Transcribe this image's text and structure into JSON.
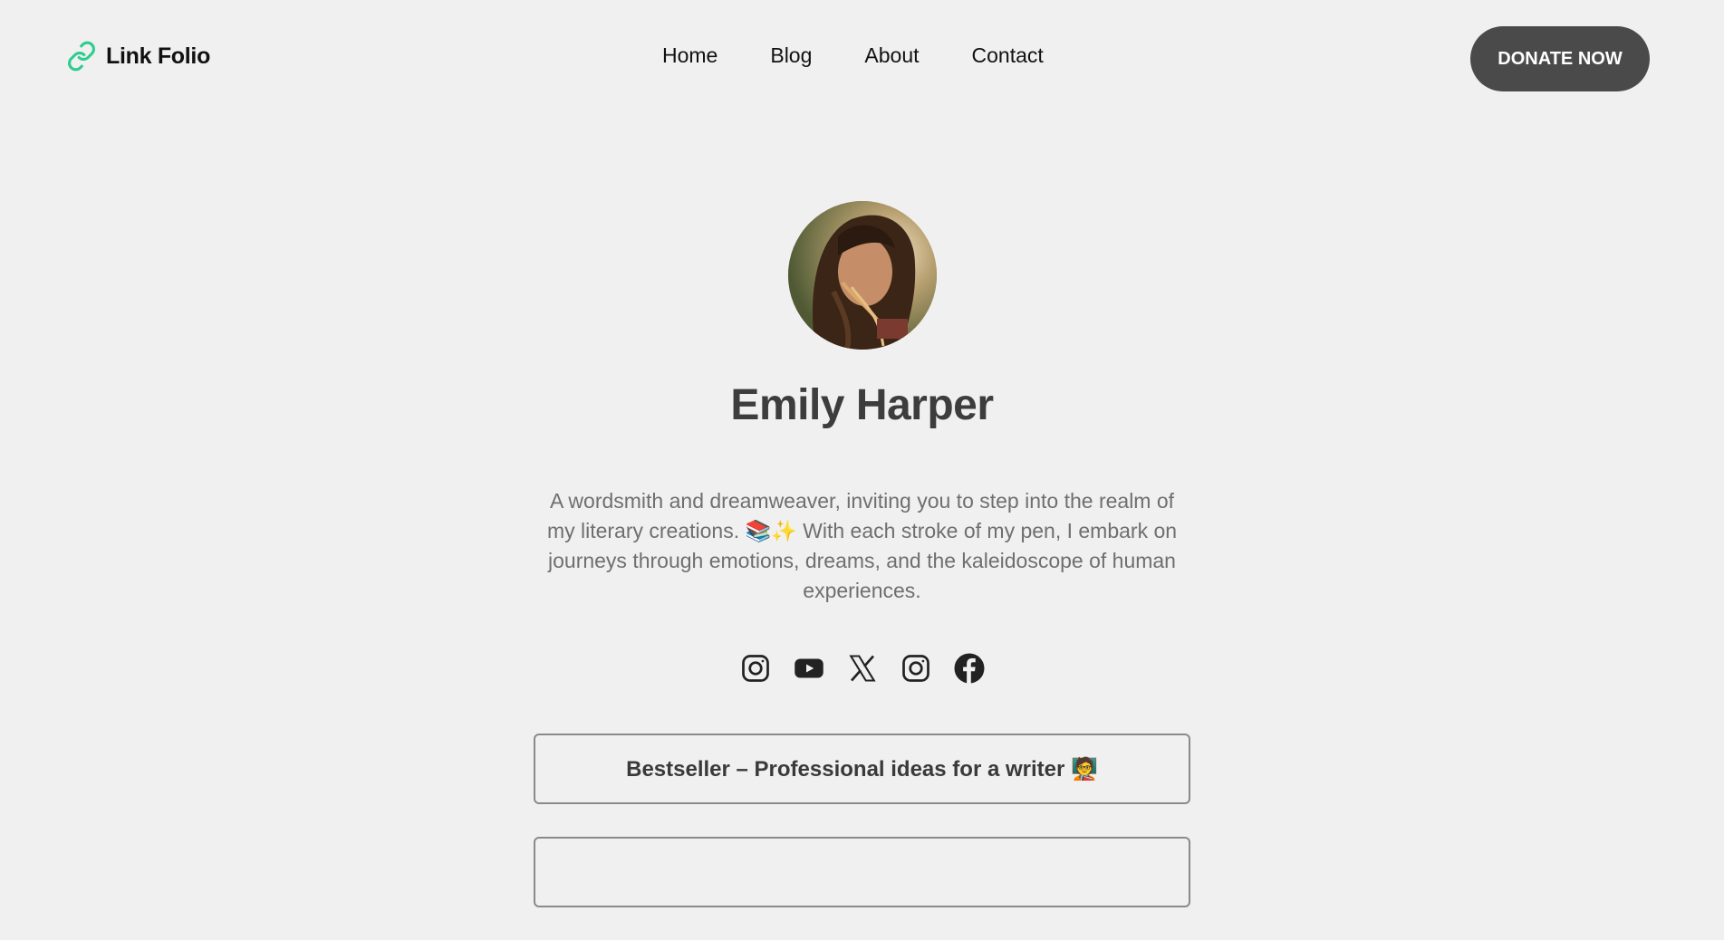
{
  "header": {
    "logo_text": "Link Folio",
    "logo_icon": "link-icon",
    "nav": [
      {
        "label": "Home"
      },
      {
        "label": "Blog"
      },
      {
        "label": "About"
      },
      {
        "label": "Contact"
      }
    ],
    "donate_label": "DONATE NOW"
  },
  "profile": {
    "name": "Emily Harper",
    "bio": "A wordsmith and dreamweaver, inviting you to step into the realm of my literary creations. 📚✨ With each stroke of my pen, I embark on journeys through emotions, dreams, and the kaleidoscope of human experiences.",
    "socials": [
      {
        "icon": "instagram-icon"
      },
      {
        "icon": "youtube-icon"
      },
      {
        "icon": "x-icon"
      },
      {
        "icon": "instagram-icon"
      },
      {
        "icon": "facebook-icon"
      }
    ]
  },
  "links": [
    {
      "label": "Bestseller – Professional ideas for a writer 🧑‍🏫"
    },
    {
      "label": ""
    }
  ],
  "colors": {
    "background": "#f0f0f0",
    "accent": "#2ecc8f",
    "button": "#4a4a4a"
  }
}
